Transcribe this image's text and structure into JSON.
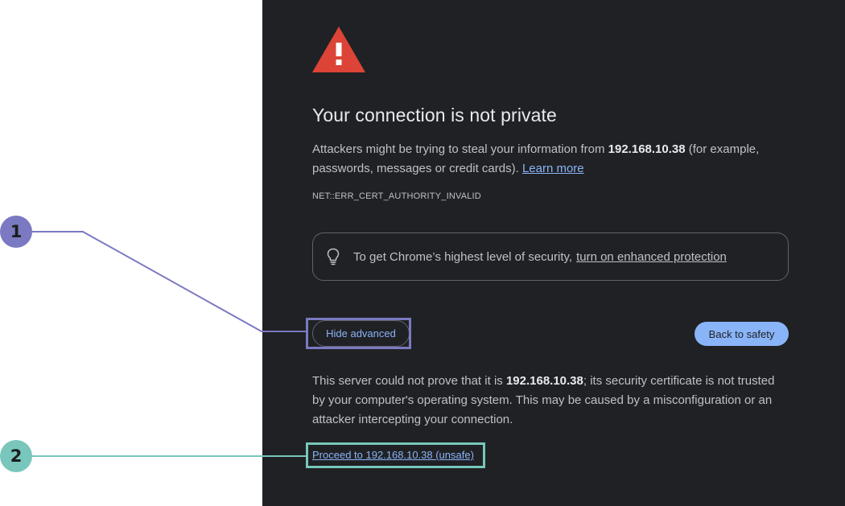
{
  "annotations": {
    "marker_1": "1",
    "marker_2": "2",
    "colors": {
      "marker_1": "#7a79c2",
      "marker_2": "#78c6bc"
    }
  },
  "page": {
    "heading": "Your connection is not private",
    "intro_before_host": "Attackers might be trying to steal your information from ",
    "host": "192.168.10.38",
    "intro_after_host": " (for example, passwords, messages or credit cards). ",
    "learn_more_label": "Learn more",
    "error_code": "NET::ERR_CERT_AUTHORITY_INVALID",
    "enhanced_text": "To get Chrome’s highest level of security,",
    "enhanced_link": "turn on enhanced protection",
    "hide_advanced_label": "Hide advanced",
    "back_to_safety_label": "Back to safety",
    "detail_before_host": "This server could not prove that it is ",
    "detail_after_host": "; its security certificate is not trusted by your computer's operating system. This may be caused by a misconfiguration or an attacker intercepting your connection.",
    "proceed_label": "Proceed to 192.168.10.38 (unsafe)",
    "icons": {
      "warning": "warning-triangle-icon",
      "lightbulb": "lightbulb-icon"
    },
    "colors": {
      "background": "#202124",
      "text": "#bdc1c6",
      "heading": "#e8eaed",
      "link": "#8ab4f8",
      "warning_red": "#db4437",
      "primary_button": "#8ab4f8"
    }
  }
}
